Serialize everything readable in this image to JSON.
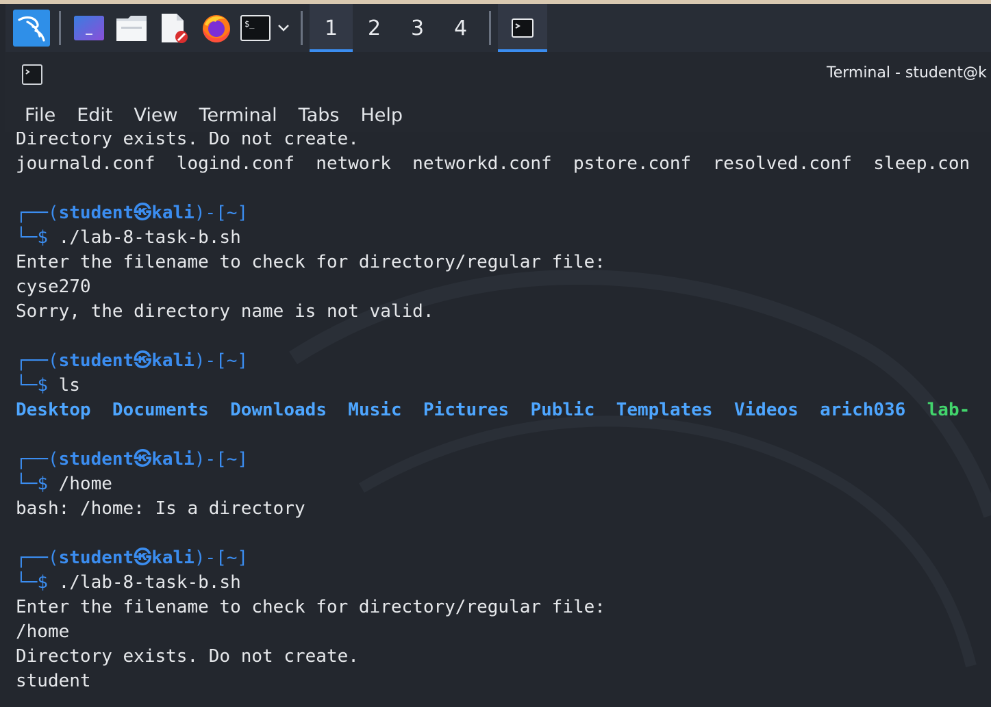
{
  "taskbar": {
    "workspaces": [
      "1",
      "2",
      "3",
      "4"
    ],
    "active_workspace_index": 0,
    "app_icons": [
      "kali-menu-icon",
      "desktop-icon",
      "file-manager-icon",
      "text-editor-icon",
      "firefox-icon",
      "terminal-icon"
    ]
  },
  "window": {
    "title": "Terminal - student@k"
  },
  "menu": {
    "file": "File",
    "edit": "Edit",
    "view": "View",
    "terminal": "Terminal",
    "tabs": "Tabs",
    "help": "Help"
  },
  "terminal": {
    "partial_line": "Directory exists. Do not create.",
    "listing_line": "journald.conf  logind.conf  network  networkd.conf  pstore.conf  resolved.conf  sleep.con",
    "prompt_top": "┌──(",
    "prompt_user": "student㉿kali",
    "prompt_path": ")-[~]",
    "prompt_bottom": "└─",
    "dollar": "$",
    "cmd1": " ./lab-8-task-b.sh",
    "out1_1": "Enter the filename to check for directory/regular file:",
    "out1_2": "cyse270",
    "out1_3": "Sorry, the directory name is not valid.",
    "cmd2": " ls",
    "ls_dirs": [
      "Desktop",
      "Documents",
      "Downloads",
      "Music",
      "Pictures",
      "Public",
      "Templates",
      "Videos",
      "arich036"
    ],
    "ls_exe": "lab-",
    "cmd3": " /home",
    "out3_1": "bash: /home: Is a directory",
    "cmd4": " ./lab-8-task-b.sh",
    "out4_1": "Enter the filename to check for directory/regular file:",
    "out4_2": "/home",
    "out4_3": "Directory exists. Do not create.",
    "out4_4": "student"
  },
  "colors": {
    "prompt": "#3b8df0",
    "directory": "#4ea6ff",
    "executable": "#42d56c",
    "text": "#e6e8eb",
    "background": "#23272e"
  }
}
